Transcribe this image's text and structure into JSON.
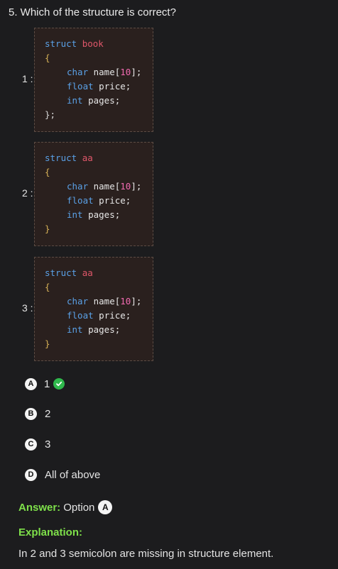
{
  "question": {
    "title": "5. Which of the structure is correct?"
  },
  "snippets": [
    {
      "number": "1 :",
      "struct_kw": "struct",
      "struct_name": "book",
      "open_brace": "{",
      "fields": [
        {
          "type": "char",
          "rest_name": " name[",
          "num": "10",
          "rest_end": "];"
        },
        {
          "type": "float",
          "rest_name": " price;",
          "num": "",
          "rest_end": ""
        },
        {
          "type": "int",
          "rest_name": " pages;",
          "num": "",
          "rest_end": ""
        }
      ],
      "close": "};"
    },
    {
      "number": "2 :",
      "struct_kw": "struct",
      "struct_name": "aa",
      "open_brace": "{",
      "fields": [
        {
          "type": "char",
          "rest_name": " name[",
          "num": "10",
          "rest_end": "];"
        },
        {
          "type": "float",
          "rest_name": " price;",
          "num": "",
          "rest_end": ""
        },
        {
          "type": "int",
          "rest_name": " pages;",
          "num": "",
          "rest_end": ""
        }
      ],
      "close": "}"
    },
    {
      "number": "3 :",
      "struct_kw": "struct",
      "struct_name": "aa",
      "open_brace": "{",
      "fields": [
        {
          "type": "char",
          "rest_name": " name[",
          "num": "10",
          "rest_end": "];"
        },
        {
          "type": "float",
          "rest_name": " price;",
          "num": "",
          "rest_end": ""
        },
        {
          "type": "int",
          "rest_name": " pages;",
          "num": "",
          "rest_end": ""
        }
      ],
      "close": "}"
    }
  ],
  "options": [
    {
      "letter": "A",
      "text": "1",
      "correct": true
    },
    {
      "letter": "B",
      "text": "2",
      "correct": false
    },
    {
      "letter": "C",
      "text": "3",
      "correct": false
    },
    {
      "letter": "D",
      "text": "All of above",
      "correct": false
    }
  ],
  "answer": {
    "label": "Answer:",
    "text": "Option",
    "letter": "A"
  },
  "explanation": {
    "label": "Explanation:",
    "text": "In 2 and 3 semicolon are missing in structure element."
  },
  "colors": {
    "background": "#1c1c1e",
    "code_background": "#2a201e",
    "keyword": "#5aa0e6",
    "struct_name": "#e0576a",
    "number": "#f06ab0",
    "brace": "#d7b257",
    "accent_green": "#7ee04a",
    "check_green": "#2fb84c"
  },
  "icons": {
    "correct": "check-circle-icon"
  }
}
